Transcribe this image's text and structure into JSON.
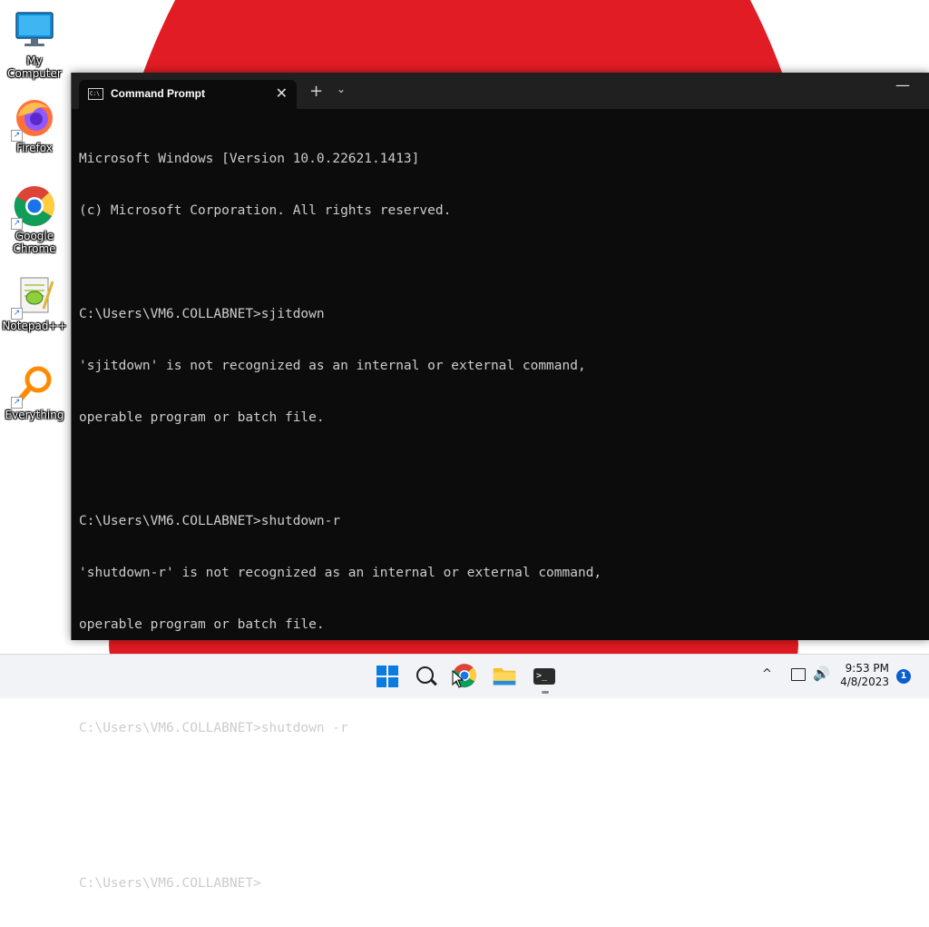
{
  "desktop": {
    "icons": [
      {
        "label": "My Computer",
        "icon": "monitor-icon"
      },
      {
        "label": "Firefox",
        "icon": "firefox-icon"
      },
      {
        "label": "Google Chrome",
        "icon": "chrome-icon"
      },
      {
        "label": "Notepad++",
        "icon": "notepadpp-icon"
      },
      {
        "label": "Everything",
        "icon": "search-tool-icon"
      }
    ]
  },
  "window": {
    "tab_title": "Command Prompt",
    "tab_icon_text": "C:\\",
    "close_glyph": "✕",
    "new_tab_glyph": "+",
    "dropdown_glyph": "⌄",
    "minimize_glyph": "—"
  },
  "console": {
    "lines": [
      "Microsoft Windows [Version 10.0.22621.1413]",
      "(c) Microsoft Corporation. All rights reserved.",
      "",
      "C:\\Users\\VM6.COLLABNET>sjitdown",
      "'sjitdown' is not recognized as an internal or external command,",
      "operable program or batch file.",
      "",
      "C:\\Users\\VM6.COLLABNET>shutdown-r",
      "'shutdown-r' is not recognized as an internal or external command,",
      "operable program or batch file.",
      "",
      "C:\\Users\\VM6.COLLABNET>shutdown -r",
      "",
      "",
      "C:\\Users\\VM6.COLLABNET>"
    ]
  },
  "taskbar": {
    "terminal_icon_text": ">_",
    "clock_time": "9:53 PM",
    "clock_date": "4/8/2023",
    "notification_count": "1",
    "chevron_glyph": "^",
    "volume_glyph": "🔊"
  },
  "colors": {
    "wallpaper_red": "#e21c24",
    "console_bg": "#0c0c0c",
    "console_text": "#cccccc",
    "accent": "#0a7be0"
  }
}
